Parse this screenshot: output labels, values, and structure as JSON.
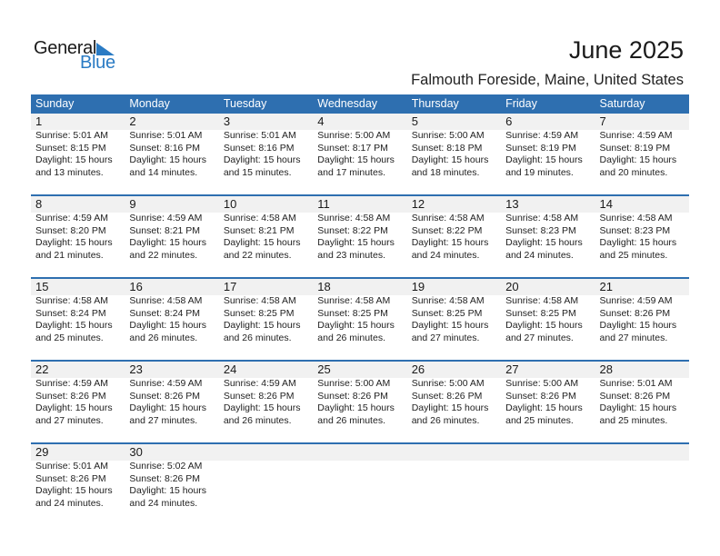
{
  "logo": {
    "word1": "General",
    "word2": "Blue"
  },
  "header": {
    "title": "June 2025",
    "location": "Falmouth Foreside, Maine, United States"
  },
  "colors": {
    "accent": "#2e6fb0",
    "row_bg": "#f1f1f1",
    "logo_blue": "#2a7bc4"
  },
  "weekdays": [
    "Sunday",
    "Monday",
    "Tuesday",
    "Wednesday",
    "Thursday",
    "Friday",
    "Saturday"
  ],
  "weeks": [
    [
      {
        "day": "1",
        "sunrise": "Sunrise: 5:01 AM",
        "sunset": "Sunset: 8:15 PM",
        "daylight1": "Daylight: 15 hours",
        "daylight2": "and 13 minutes."
      },
      {
        "day": "2",
        "sunrise": "Sunrise: 5:01 AM",
        "sunset": "Sunset: 8:16 PM",
        "daylight1": "Daylight: 15 hours",
        "daylight2": "and 14 minutes."
      },
      {
        "day": "3",
        "sunrise": "Sunrise: 5:01 AM",
        "sunset": "Sunset: 8:16 PM",
        "daylight1": "Daylight: 15 hours",
        "daylight2": "and 15 minutes."
      },
      {
        "day": "4",
        "sunrise": "Sunrise: 5:00 AM",
        "sunset": "Sunset: 8:17 PM",
        "daylight1": "Daylight: 15 hours",
        "daylight2": "and 17 minutes."
      },
      {
        "day": "5",
        "sunrise": "Sunrise: 5:00 AM",
        "sunset": "Sunset: 8:18 PM",
        "daylight1": "Daylight: 15 hours",
        "daylight2": "and 18 minutes."
      },
      {
        "day": "6",
        "sunrise": "Sunrise: 4:59 AM",
        "sunset": "Sunset: 8:19 PM",
        "daylight1": "Daylight: 15 hours",
        "daylight2": "and 19 minutes."
      },
      {
        "day": "7",
        "sunrise": "Sunrise: 4:59 AM",
        "sunset": "Sunset: 8:19 PM",
        "daylight1": "Daylight: 15 hours",
        "daylight2": "and 20 minutes."
      }
    ],
    [
      {
        "day": "8",
        "sunrise": "Sunrise: 4:59 AM",
        "sunset": "Sunset: 8:20 PM",
        "daylight1": "Daylight: 15 hours",
        "daylight2": "and 21 minutes."
      },
      {
        "day": "9",
        "sunrise": "Sunrise: 4:59 AM",
        "sunset": "Sunset: 8:21 PM",
        "daylight1": "Daylight: 15 hours",
        "daylight2": "and 22 minutes."
      },
      {
        "day": "10",
        "sunrise": "Sunrise: 4:58 AM",
        "sunset": "Sunset: 8:21 PM",
        "daylight1": "Daylight: 15 hours",
        "daylight2": "and 22 minutes."
      },
      {
        "day": "11",
        "sunrise": "Sunrise: 4:58 AM",
        "sunset": "Sunset: 8:22 PM",
        "daylight1": "Daylight: 15 hours",
        "daylight2": "and 23 minutes."
      },
      {
        "day": "12",
        "sunrise": "Sunrise: 4:58 AM",
        "sunset": "Sunset: 8:22 PM",
        "daylight1": "Daylight: 15 hours",
        "daylight2": "and 24 minutes."
      },
      {
        "day": "13",
        "sunrise": "Sunrise: 4:58 AM",
        "sunset": "Sunset: 8:23 PM",
        "daylight1": "Daylight: 15 hours",
        "daylight2": "and 24 minutes."
      },
      {
        "day": "14",
        "sunrise": "Sunrise: 4:58 AM",
        "sunset": "Sunset: 8:23 PM",
        "daylight1": "Daylight: 15 hours",
        "daylight2": "and 25 minutes."
      }
    ],
    [
      {
        "day": "15",
        "sunrise": "Sunrise: 4:58 AM",
        "sunset": "Sunset: 8:24 PM",
        "daylight1": "Daylight: 15 hours",
        "daylight2": "and 25 minutes."
      },
      {
        "day": "16",
        "sunrise": "Sunrise: 4:58 AM",
        "sunset": "Sunset: 8:24 PM",
        "daylight1": "Daylight: 15 hours",
        "daylight2": "and 26 minutes."
      },
      {
        "day": "17",
        "sunrise": "Sunrise: 4:58 AM",
        "sunset": "Sunset: 8:25 PM",
        "daylight1": "Daylight: 15 hours",
        "daylight2": "and 26 minutes."
      },
      {
        "day": "18",
        "sunrise": "Sunrise: 4:58 AM",
        "sunset": "Sunset: 8:25 PM",
        "daylight1": "Daylight: 15 hours",
        "daylight2": "and 26 minutes."
      },
      {
        "day": "19",
        "sunrise": "Sunrise: 4:58 AM",
        "sunset": "Sunset: 8:25 PM",
        "daylight1": "Daylight: 15 hours",
        "daylight2": "and 27 minutes."
      },
      {
        "day": "20",
        "sunrise": "Sunrise: 4:58 AM",
        "sunset": "Sunset: 8:25 PM",
        "daylight1": "Daylight: 15 hours",
        "daylight2": "and 27 minutes."
      },
      {
        "day": "21",
        "sunrise": "Sunrise: 4:59 AM",
        "sunset": "Sunset: 8:26 PM",
        "daylight1": "Daylight: 15 hours",
        "daylight2": "and 27 minutes."
      }
    ],
    [
      {
        "day": "22",
        "sunrise": "Sunrise: 4:59 AM",
        "sunset": "Sunset: 8:26 PM",
        "daylight1": "Daylight: 15 hours",
        "daylight2": "and 27 minutes."
      },
      {
        "day": "23",
        "sunrise": "Sunrise: 4:59 AM",
        "sunset": "Sunset: 8:26 PM",
        "daylight1": "Daylight: 15 hours",
        "daylight2": "and 27 minutes."
      },
      {
        "day": "24",
        "sunrise": "Sunrise: 4:59 AM",
        "sunset": "Sunset: 8:26 PM",
        "daylight1": "Daylight: 15 hours",
        "daylight2": "and 26 minutes."
      },
      {
        "day": "25",
        "sunrise": "Sunrise: 5:00 AM",
        "sunset": "Sunset: 8:26 PM",
        "daylight1": "Daylight: 15 hours",
        "daylight2": "and 26 minutes."
      },
      {
        "day": "26",
        "sunrise": "Sunrise: 5:00 AM",
        "sunset": "Sunset: 8:26 PM",
        "daylight1": "Daylight: 15 hours",
        "daylight2": "and 26 minutes."
      },
      {
        "day": "27",
        "sunrise": "Sunrise: 5:00 AM",
        "sunset": "Sunset: 8:26 PM",
        "daylight1": "Daylight: 15 hours",
        "daylight2": "and 25 minutes."
      },
      {
        "day": "28",
        "sunrise": "Sunrise: 5:01 AM",
        "sunset": "Sunset: 8:26 PM",
        "daylight1": "Daylight: 15 hours",
        "daylight2": "and 25 minutes."
      }
    ],
    [
      {
        "day": "29",
        "sunrise": "Sunrise: 5:01 AM",
        "sunset": "Sunset: 8:26 PM",
        "daylight1": "Daylight: 15 hours",
        "daylight2": "and 24 minutes."
      },
      {
        "day": "30",
        "sunrise": "Sunrise: 5:02 AM",
        "sunset": "Sunset: 8:26 PM",
        "daylight1": "Daylight: 15 hours",
        "daylight2": "and 24 minutes."
      },
      {
        "day": "",
        "sunrise": "",
        "sunset": "",
        "daylight1": "",
        "daylight2": ""
      },
      {
        "day": "",
        "sunrise": "",
        "sunset": "",
        "daylight1": "",
        "daylight2": ""
      },
      {
        "day": "",
        "sunrise": "",
        "sunset": "",
        "daylight1": "",
        "daylight2": ""
      },
      {
        "day": "",
        "sunrise": "",
        "sunset": "",
        "daylight1": "",
        "daylight2": ""
      },
      {
        "day": "",
        "sunrise": "",
        "sunset": "",
        "daylight1": "",
        "daylight2": ""
      }
    ]
  ]
}
